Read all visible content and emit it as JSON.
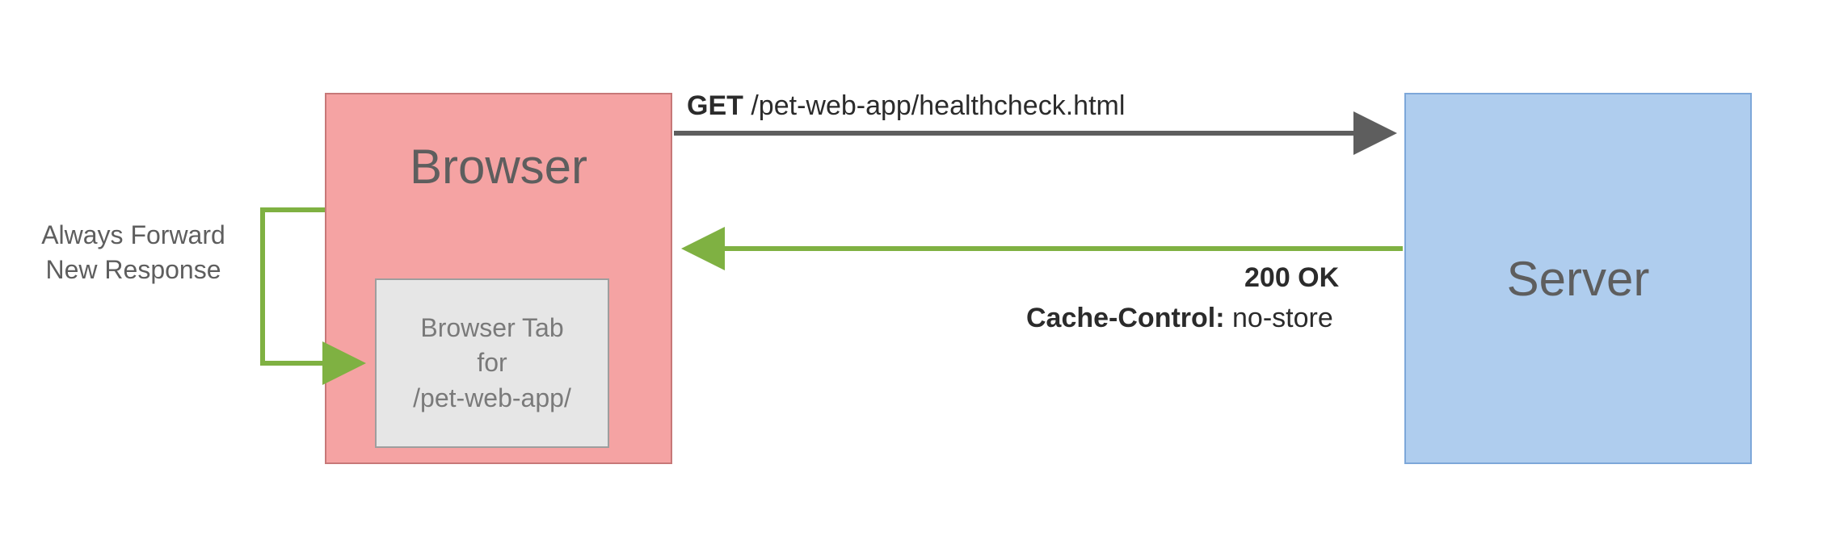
{
  "browser": {
    "title": "Browser",
    "tab": {
      "line1": "Browser Tab",
      "line2": "for",
      "line3": "/pet-web-app/"
    }
  },
  "server": {
    "title": "Server"
  },
  "forward_note": {
    "line1": "Always Forward",
    "line2": "New Response"
  },
  "request": {
    "method": "GET",
    "path": " /pet-web-app/healthcheck.html"
  },
  "response": {
    "status": "200 OK",
    "header_name": "Cache-Control:",
    "header_value": " no-store"
  },
  "colors": {
    "browser_fill": "#f5a3a3",
    "server_fill": "#afcdee",
    "tab_fill": "#e6e6e6",
    "arrow_gray": "#5e5e5e",
    "arrow_green": "#7fb142"
  }
}
